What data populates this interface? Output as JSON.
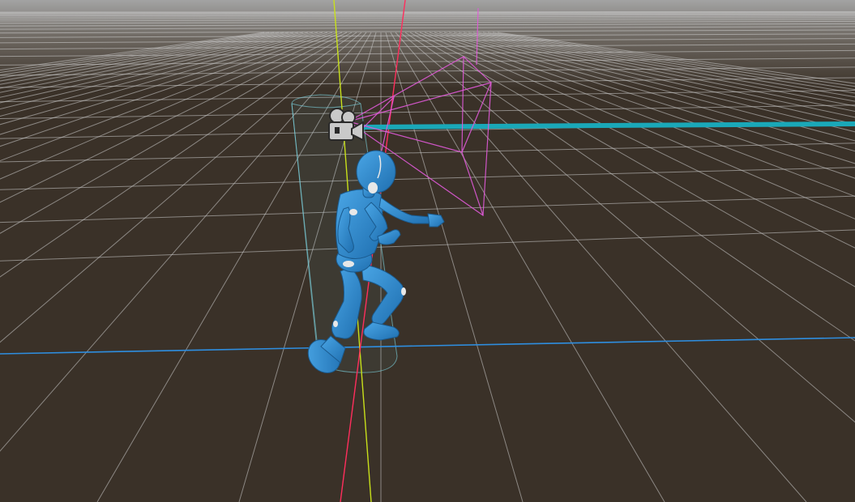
{
  "viewport": {
    "view": "perspective",
    "colors": {
      "ground": "#3a3128",
      "sky_top": "#9a9a9a",
      "grid_line": "#cfcfcf",
      "axis_x": "#2e8ee0",
      "axis_y": "#c8e01a",
      "axis_z": "#ff2e5c",
      "character": "#2f8fd4",
      "character_joint": "#e8e8e8",
      "camera_frustum": "#e05ad8",
      "camera_gizmo": "#c9c9c9",
      "camera_line": "#1aa8b8",
      "capsule_collider": "#7fd8e6"
    },
    "objects": [
      {
        "name": "character",
        "icon": "humanoid-mannequin",
        "selected": true
      },
      {
        "name": "camera",
        "icon": "movie-camera-icon"
      },
      {
        "name": "camera-frustum",
        "icon": "frustum-wireframe"
      },
      {
        "name": "capsule-collider",
        "icon": "capsule-wireframe"
      }
    ]
  }
}
